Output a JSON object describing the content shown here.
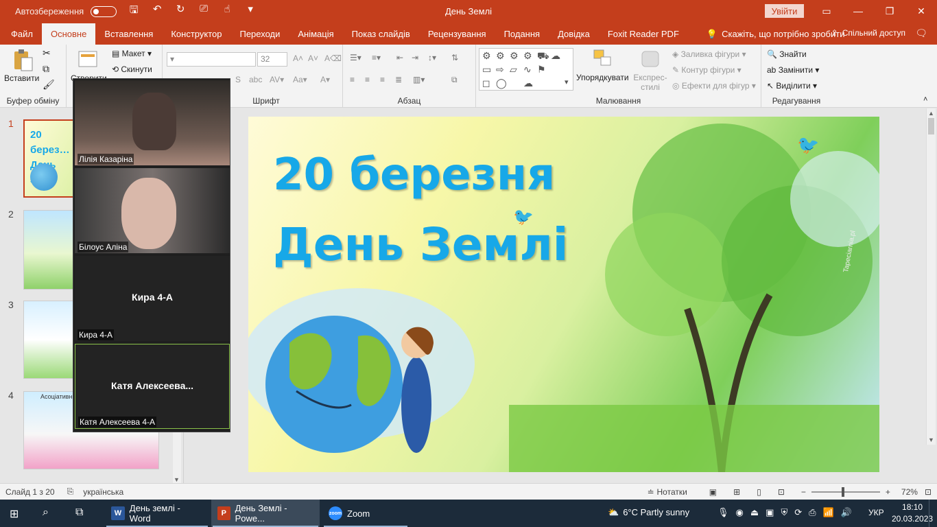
{
  "titlebar": {
    "autosave_label": "Автозбереження",
    "doc_title": "День Землі",
    "signin_label": "Увійти"
  },
  "tabs": [
    "Файл",
    "Основне",
    "Вставлення",
    "Конструктор",
    "Переходи",
    "Анімація",
    "Показ слайдів",
    "Рецензування",
    "Подання",
    "Довідка",
    "Foxit Reader PDF"
  ],
  "active_tab": "Основне",
  "tellme_label": "Скажіть, що потрібно зробити",
  "share_label": "Спільний доступ",
  "ribbon": {
    "clipboard": {
      "paste_label": "Вставити",
      "group_label": "Буфер обміну"
    },
    "slides": {
      "new_label": "Створити",
      "layout_label": "Макет",
      "reset_label": "Скинути"
    },
    "font": {
      "group_label": "Шрифт",
      "font_size": "32"
    },
    "paragraph": {
      "group_label": "Абзац"
    },
    "drawing": {
      "arrange_label": "Упорядкувати",
      "quick_styles_label": "Експрес-стилі",
      "fill_label": "Заливка фігури",
      "outline_label": "Контур фігури",
      "effects_label": "Ефекти для фігур",
      "group_label": "Малювання"
    },
    "editing": {
      "find_label": "Знайти",
      "replace_label": "Замінити",
      "select_label": "Виділити",
      "group_label": "Редагування"
    }
  },
  "thumbnails": [
    {
      "number": "1",
      "text": "20 берез… День Зе…"
    },
    {
      "number": "2"
    },
    {
      "number": "3"
    },
    {
      "number": "4",
      "text": "Асоціативни…"
    }
  ],
  "zoom_participants": [
    {
      "name": "Лілія Казаріна",
      "video": true
    },
    {
      "name": "Білоус Аліна",
      "video": true
    },
    {
      "name": "Кира 4-А",
      "display": "Кира 4-А",
      "video": false
    },
    {
      "name": "Катя Алексеева 4-А",
      "display": "Катя  Алексеева...",
      "video": false,
      "speaking": true
    }
  ],
  "slide": {
    "title_line1": "20 березня",
    "title_line2": "День Землі",
    "watermark": "Tapeciarnia.pl"
  },
  "statusbar": {
    "slide_info": "Слайд 1 з 20",
    "language": "українська",
    "notes_label": "Нотатки",
    "zoom_level": "72%"
  },
  "taskbar": {
    "apps": [
      {
        "label": "День землі - Word",
        "color": "#2b579a",
        "letter": "W"
      },
      {
        "label": "День Землі - Powe...",
        "color": "#c43e1c",
        "letter": "P",
        "active": true
      },
      {
        "label": "Zoom",
        "color": "#2d8cff",
        "letter": "zoom"
      }
    ],
    "weather": "6°C  Partly sunny",
    "language": "УКР",
    "time": "18:10",
    "date": "20.03.2023"
  },
  "colors": {
    "accent": "#c43e1c",
    "title_blue": "#17a8e8",
    "taskbar": "#1c2b3a"
  }
}
